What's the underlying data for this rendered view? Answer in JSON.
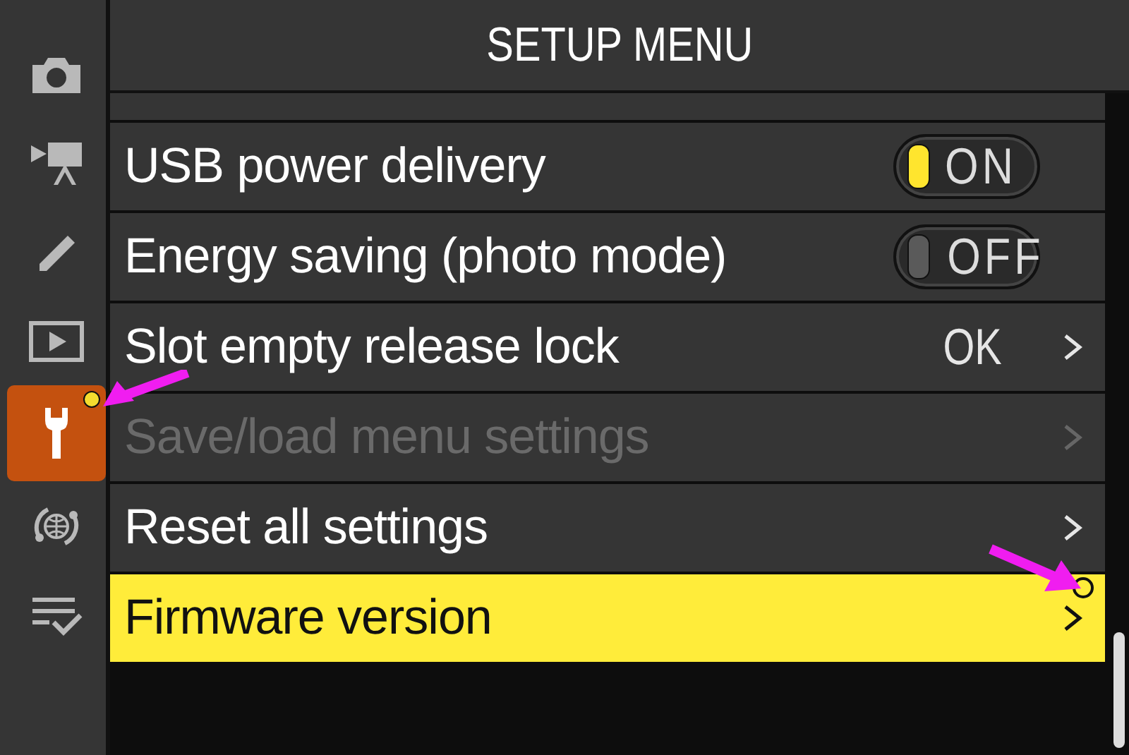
{
  "sidebar": {
    "items": [
      {
        "kind": "camera",
        "selected": false,
        "new_marker": false
      },
      {
        "kind": "movie",
        "selected": false,
        "new_marker": false
      },
      {
        "kind": "pencil",
        "selected": false,
        "new_marker": false
      },
      {
        "kind": "playback",
        "selected": false,
        "new_marker": false
      },
      {
        "kind": "wrench",
        "selected": true,
        "new_marker": true,
        "pointer_arrow": true
      },
      {
        "kind": "network",
        "selected": false,
        "new_marker": false
      },
      {
        "kind": "mymenu",
        "selected": false,
        "new_marker": false
      }
    ]
  },
  "header": {
    "title": "SETUP MENU"
  },
  "rows": [
    {
      "kind": "toggle",
      "label": "USB power delivery",
      "value": "ON",
      "on": true,
      "disabled": false,
      "selected": false,
      "new_marker": false
    },
    {
      "kind": "toggle",
      "label": "Energy saving (photo mode)",
      "value": "OFF",
      "on": false,
      "disabled": false,
      "selected": false,
      "new_marker": false
    },
    {
      "kind": "submenu",
      "label": "Slot empty release lock",
      "value": "OK",
      "disabled": false,
      "selected": false,
      "new_marker": false
    },
    {
      "kind": "submenu",
      "label": "Save/load menu settings",
      "disabled": true,
      "selected": false,
      "new_marker": false
    },
    {
      "kind": "submenu",
      "label": "Reset all settings",
      "disabled": false,
      "selected": false,
      "new_marker": false
    },
    {
      "kind": "submenu",
      "label": "Firmware version",
      "disabled": false,
      "selected": true,
      "new_marker": true,
      "pointer_arrow": true
    }
  ]
}
